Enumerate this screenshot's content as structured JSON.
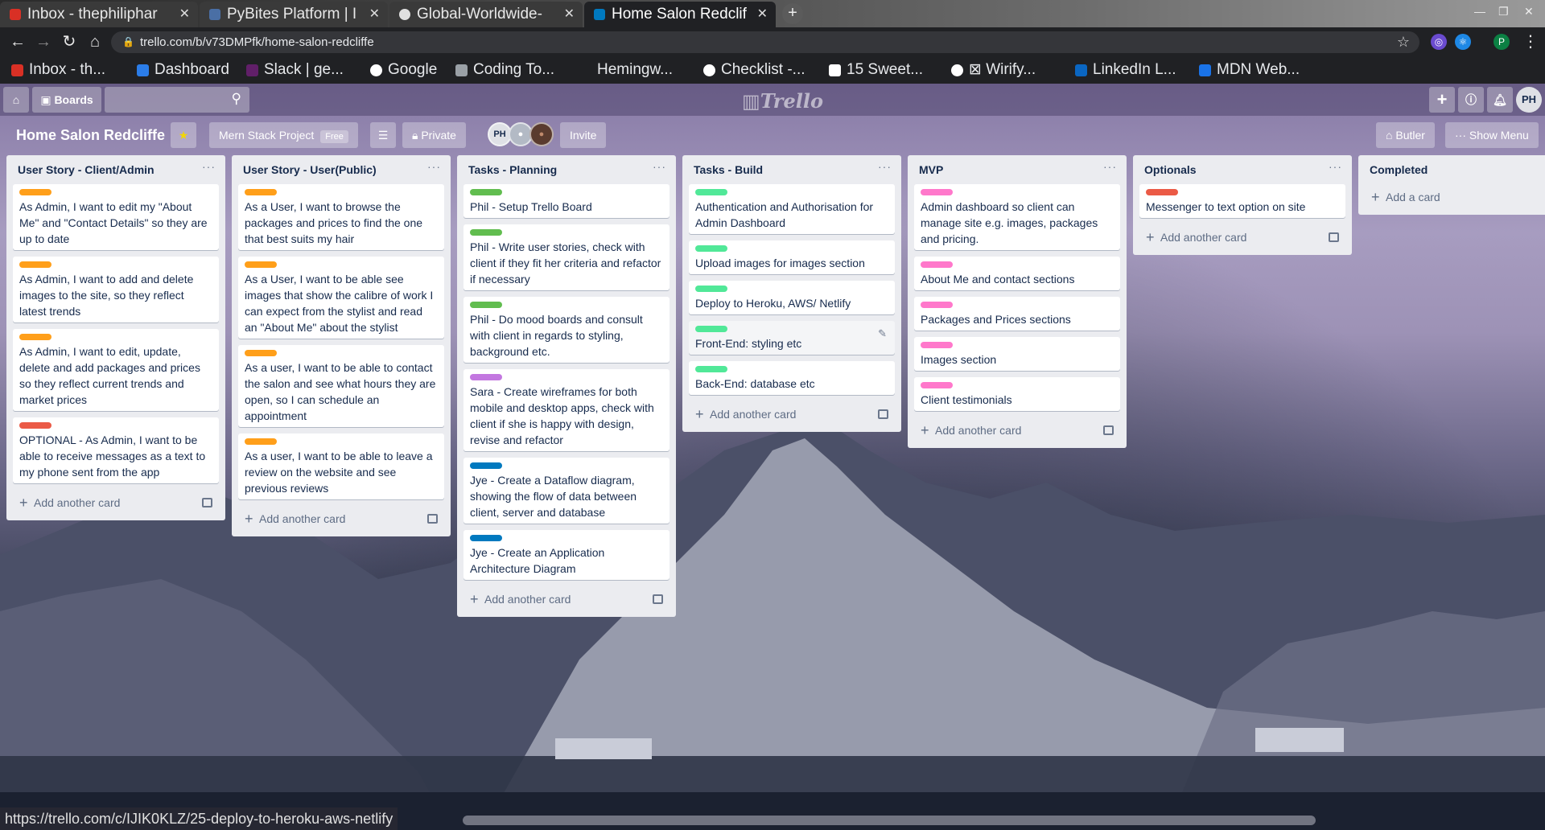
{
  "browser": {
    "tabs": [
      {
        "title": "Inbox - thephiliphar",
        "color": "#d93025"
      },
      {
        "title": "PyBites Platform | I",
        "color": "#4a6fa5"
      },
      {
        "title": "Global-Worldwide-",
        "color": "#e0e0e0"
      },
      {
        "title": "Home Salon Redclif",
        "color": "#0079bf"
      }
    ],
    "url": "trello.com/b/v73DMPfk/home-salon-redcliffe",
    "profile": "P",
    "bookmarks": [
      {
        "label": "Inbox - th...",
        "color": "#d93025"
      },
      {
        "label": "Dashboard",
        "color": "#2b7de9"
      },
      {
        "label": "Slack | ge...",
        "color": "#611f69"
      },
      {
        "label": "Google",
        "color": "#ffffff"
      },
      {
        "label": "Coding To...",
        "color": "#9aa0a6"
      },
      {
        "label": "Hemingw...",
        "color": "#202124"
      },
      {
        "label": "Checklist -...",
        "color": "#ffffff"
      },
      {
        "label": "15 Sweet...",
        "color": "#ffffff"
      },
      {
        "label": "⊠ Wirify...",
        "color": "#ffffff"
      },
      {
        "label": "LinkedIn L...",
        "color": "#0a66c2"
      },
      {
        "label": "MDN Web...",
        "color": "#1a73e8"
      }
    ],
    "status_url": "https://trello.com/c/IJIK0KLZ/25-deploy-to-heroku-aws-netlify"
  },
  "header": {
    "boards_label": "Boards",
    "logo": "Trello",
    "user_initials": "PH"
  },
  "board": {
    "title": "Home Salon Redcliffe",
    "team": "Mern Stack Project",
    "team_badge": "Free",
    "visibility": "Private",
    "members": [
      "PH",
      "",
      ""
    ],
    "invite_label": "Invite",
    "butler_label": "Butler",
    "menu_label": "Show Menu"
  },
  "colors": {
    "orange": "#ff9f1a",
    "red": "#eb5a46",
    "green": "#61bd4f",
    "purple": "#c377e0",
    "blue": "#0079bf",
    "lime": "#51e898",
    "pink": "#ff78cb"
  },
  "lists": [
    {
      "title": "User Story - Client/Admin",
      "add_label": "Add another card",
      "cards": [
        {
          "label": "orange",
          "text": "As Admin, I want to edit my \"About Me\" and \"Contact Details\" so they are up to date"
        },
        {
          "label": "orange",
          "text": "As Admin, I want to add and delete images to the site, so they reflect latest trends"
        },
        {
          "label": "orange",
          "text": "As Admin, I want to edit, update, delete and add packages and prices so they reflect current trends and market prices"
        },
        {
          "label": "red",
          "text": "OPTIONAL - As Admin, I want to be able to receive messages as a text to my phone sent from the app"
        }
      ]
    },
    {
      "title": "User Story - User(Public)",
      "add_label": "Add another card",
      "cards": [
        {
          "label": "orange",
          "text": "As a User, I want to browse the packages and prices to find the one that best suits my hair"
        },
        {
          "label": "orange",
          "text": "As a User, I want to be able see images that show the calibre of work I can expect from the stylist and read an \"About Me\" about the stylist"
        },
        {
          "label": "orange",
          "text": "As a user, I want to be able to contact the salon and see what hours they are open, so I can schedule an appointment"
        },
        {
          "label": "orange",
          "text": "As a user, I want to be able to leave a review on the website and see previous reviews"
        }
      ]
    },
    {
      "title": "Tasks - Planning",
      "add_label": "Add another card",
      "cards": [
        {
          "label": "green",
          "text": "Phil - Setup Trello Board"
        },
        {
          "label": "green",
          "text": "Phil - Write user stories, check with client if they fit her criteria and refactor if necessary"
        },
        {
          "label": "green",
          "text": "Phil - Do mood boards and consult with client in regards to styling, background etc."
        },
        {
          "label": "purple",
          "text": "Sara - Create wireframes for both mobile and desktop apps, check with client if she is happy with design, revise and refactor"
        },
        {
          "label": "blue",
          "text": "Jye - Create a Dataflow diagram, showing the flow of data between client, server and database"
        },
        {
          "label": "blue",
          "text": "Jye - Create an Application Architecture Diagram"
        }
      ]
    },
    {
      "title": "Tasks - Build",
      "add_label": "Add another card",
      "cards": [
        {
          "label": "lime",
          "text": "Authentication and Authorisation for Admin Dashboard"
        },
        {
          "label": "lime",
          "text": "Upload images for images section"
        },
        {
          "label": "lime",
          "text": "Deploy to Heroku, AWS/ Netlify"
        },
        {
          "label": "lime",
          "text": "Front-End: styling etc"
        },
        {
          "label": "lime",
          "text": "Back-End: database etc"
        }
      ]
    },
    {
      "title": "MVP",
      "add_label": "Add another card",
      "cards": [
        {
          "label": "pink",
          "text": "Admin dashboard so client can manage site e.g. images, packages and pricing."
        },
        {
          "label": "pink",
          "text": "About Me and contact sections"
        },
        {
          "label": "pink",
          "text": "Packages and Prices sections"
        },
        {
          "label": "pink",
          "text": "Images section"
        },
        {
          "label": "pink",
          "text": "Client testimonials"
        }
      ]
    },
    {
      "title": "Optionals",
      "add_label": "Add another card",
      "cards": [
        {
          "label": "red",
          "text": "Messenger to text option on site"
        }
      ]
    },
    {
      "title": "Completed",
      "add_label": "Add a card",
      "cards": []
    }
  ]
}
